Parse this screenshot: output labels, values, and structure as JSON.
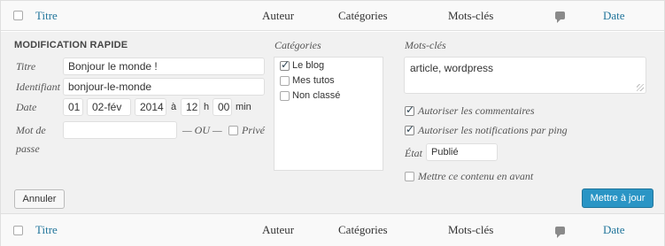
{
  "columns": {
    "title": "Titre",
    "author": "Auteur",
    "categories": "Catégories",
    "tags": "Mots-clés",
    "comments_icon": "comment-bubble-icon",
    "date": "Date"
  },
  "quick_edit": {
    "heading": "MODIFICATION RAPIDE",
    "title_label": "Titre",
    "title_value": "Bonjour le monde !",
    "slug_label": "Identifiant",
    "slug_value": "bonjour-le-monde",
    "date_label": "Date",
    "day": "01",
    "month": "02-fév",
    "year": "2014",
    "at": "à",
    "hour": "12",
    "h": "h",
    "minute": "00",
    "min": "min",
    "password_label_1": "Mot de",
    "password_label_2": "passe",
    "password_value": "",
    "or": "— OU —",
    "private_label": "Privé",
    "private_checked": false,
    "categories_label": "Catégories",
    "categories": [
      {
        "label": "Le blog",
        "checked": true
      },
      {
        "label": "Mes tutos",
        "checked": false
      },
      {
        "label": "Non classé",
        "checked": false
      }
    ],
    "tags_label": "Mots-clés",
    "tags_value": "article,  wordpress",
    "allow_comments": "Autoriser les commentaires",
    "allow_comments_checked": true,
    "allow_pings": "Autoriser les notifications par ping",
    "allow_pings_checked": true,
    "status_label": "État",
    "status_value": "Publié",
    "sticky": "Mettre ce contenu en avant",
    "sticky_checked": false,
    "cancel": "Annuler",
    "update": "Mettre à jour"
  },
  "colors": {
    "link": "#21759b",
    "panel_bg": "#f1f1f1",
    "primary_button": "#2a95c5"
  }
}
